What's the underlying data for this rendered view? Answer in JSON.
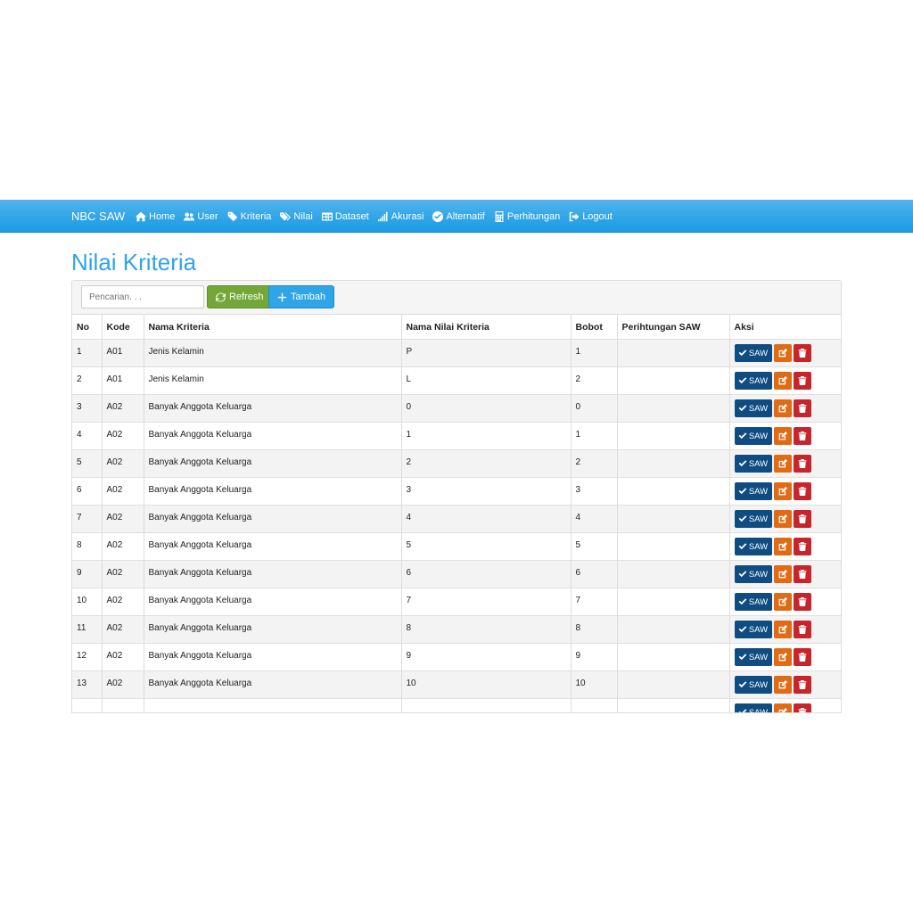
{
  "nav": {
    "brand": "NBC SAW",
    "items": [
      {
        "label": "Home",
        "icon": "home-icon"
      },
      {
        "label": "User",
        "icon": "users-icon"
      },
      {
        "label": "Kriteria",
        "icon": "tag-icon"
      },
      {
        "label": "Nilai",
        "icon": "tags-icon"
      },
      {
        "label": "Dataset",
        "icon": "table-icon"
      },
      {
        "label": "Akurasi",
        "icon": "signal-icon"
      },
      {
        "label": "Alternatif",
        "icon": "check-circle-icon"
      },
      {
        "label": "Perhitungan",
        "icon": "calculator-icon"
      },
      {
        "label": "Logout",
        "icon": "sign-out-icon"
      }
    ]
  },
  "page": {
    "title": "Nilai Kriteria",
    "search_placeholder": "Pencarian. . .",
    "refresh_label": "Refresh",
    "tambah_label": "Tambah"
  },
  "table": {
    "headers": [
      "No",
      "Kode",
      "Nama Kriteria",
      "Nama Nilai Kriteria",
      "Bobot",
      "Perihtungan SAW",
      "Aksi"
    ],
    "saw_label": "SAW",
    "rows": [
      {
        "no": "1",
        "kode": "A01",
        "nama": "Jenis Kelamin",
        "nilai": "P",
        "bobot": "1",
        "saw": ""
      },
      {
        "no": "2",
        "kode": "A01",
        "nama": "Jenis Kelamin",
        "nilai": "L",
        "bobot": "2",
        "saw": ""
      },
      {
        "no": "3",
        "kode": "A02",
        "nama": "Banyak Anggota Keluarga",
        "nilai": "0",
        "bobot": "0",
        "saw": ""
      },
      {
        "no": "4",
        "kode": "A02",
        "nama": "Banyak Anggota Keluarga",
        "nilai": "1",
        "bobot": "1",
        "saw": ""
      },
      {
        "no": "5",
        "kode": "A02",
        "nama": "Banyak Anggota Keluarga",
        "nilai": "2",
        "bobot": "2",
        "saw": ""
      },
      {
        "no": "6",
        "kode": "A02",
        "nama": "Banyak Anggota Keluarga",
        "nilai": "3",
        "bobot": "3",
        "saw": ""
      },
      {
        "no": "7",
        "kode": "A02",
        "nama": "Banyak Anggota Keluarga",
        "nilai": "4",
        "bobot": "4",
        "saw": ""
      },
      {
        "no": "8",
        "kode": "A02",
        "nama": "Banyak Anggota Keluarga",
        "nilai": "5",
        "bobot": "5",
        "saw": ""
      },
      {
        "no": "9",
        "kode": "A02",
        "nama": "Banyak Anggota Keluarga",
        "nilai": "6",
        "bobot": "6",
        "saw": ""
      },
      {
        "no": "10",
        "kode": "A02",
        "nama": "Banyak Anggota Keluarga",
        "nilai": "7",
        "bobot": "7",
        "saw": ""
      },
      {
        "no": "11",
        "kode": "A02",
        "nama": "Banyak Anggota Keluarga",
        "nilai": "8",
        "bobot": "8",
        "saw": ""
      },
      {
        "no": "12",
        "kode": "A02",
        "nama": "Banyak Anggota Keluarga",
        "nilai": "9",
        "bobot": "9",
        "saw": ""
      },
      {
        "no": "13",
        "kode": "A02",
        "nama": "Banyak Anggota Keluarga",
        "nilai": "10",
        "bobot": "10",
        "saw": ""
      },
      {
        "no": "",
        "kode": "",
        "nama": "",
        "nilai": "",
        "bobot": "",
        "saw": ""
      }
    ]
  },
  "colors": {
    "primary": "#2fa4e7",
    "success": "#73a839",
    "saw": "#0f4c81",
    "edit": "#e06b14",
    "delete": "#c7242b"
  }
}
